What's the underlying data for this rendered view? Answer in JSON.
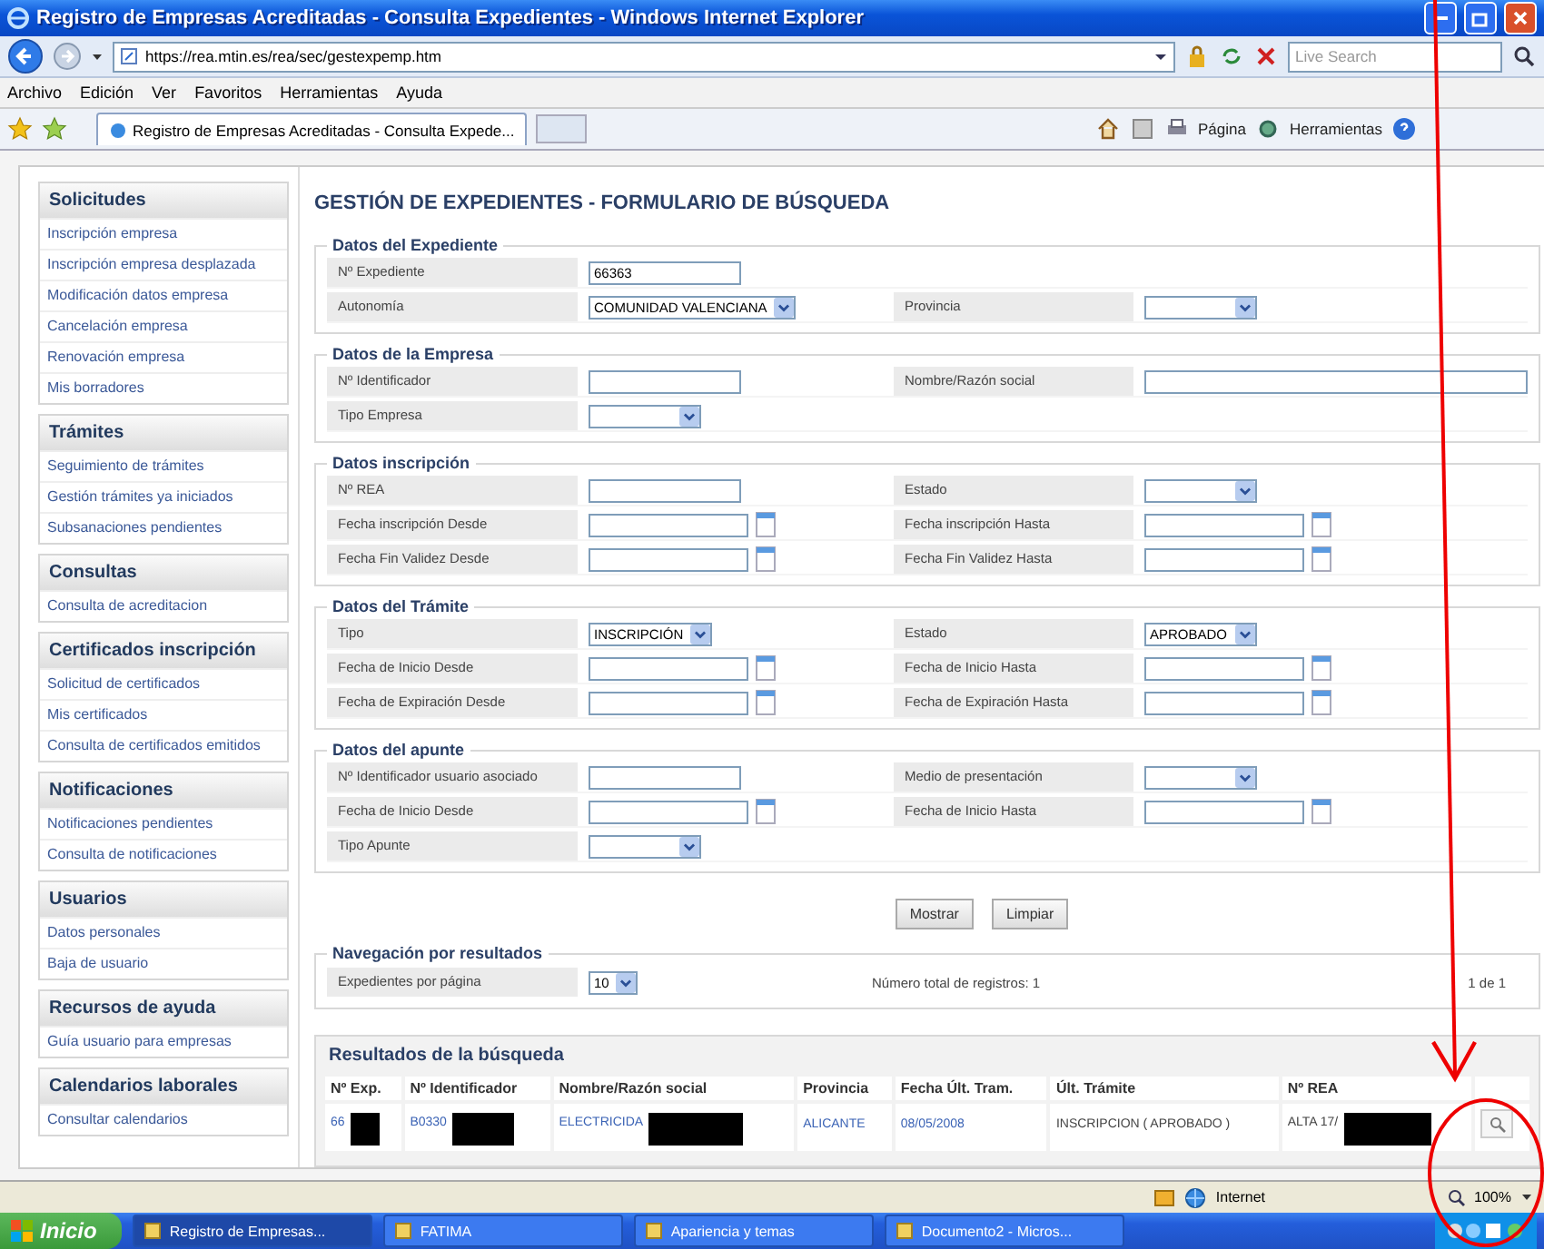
{
  "window": {
    "title": "Registro de Empresas Acreditadas - Consulta Expedientes - Windows Internet Explorer"
  },
  "address_bar": {
    "url": "https://rea.mtin.es/rea/sec/gestexpemp.htm",
    "search_placeholder": "Live Search"
  },
  "menu_bar": [
    "Archivo",
    "Edición",
    "Ver",
    "Favoritos",
    "Herramientas",
    "Ayuda"
  ],
  "browser_tabs": [
    {
      "label": "Registro de Empresas Acreditadas - Consulta Expede...",
      "selected": true
    }
  ],
  "command_bar": [
    "Página",
    "Herramientas"
  ],
  "sidebar": [
    {
      "title": "Solicitudes",
      "items": [
        "Inscripción empresa",
        "Inscripción empresa desplazada",
        "Modificación datos empresa",
        "Cancelación empresa",
        "Renovación empresa",
        "Mis borradores"
      ]
    },
    {
      "title": "Trámites",
      "items": [
        "Seguimiento de trámites",
        "Gestión trámites ya iniciados",
        "Subsanaciones pendientes"
      ]
    },
    {
      "title": "Consultas",
      "items": [
        "Consulta de acreditacion"
      ]
    },
    {
      "title": "Certificados inscripción",
      "items": [
        "Solicitud de certificados",
        "Mis certificados",
        "Consulta de certificados emitidos"
      ]
    },
    {
      "title": "Notificaciones",
      "items": [
        "Notificaciones pendientes",
        "Consulta de notificaciones"
      ]
    },
    {
      "title": "Usuarios",
      "items": [
        "Datos personales",
        "Baja de usuario"
      ]
    },
    {
      "title": "Recursos de ayuda",
      "items": [
        "Guía usuario para empresas"
      ]
    },
    {
      "title": "Calendarios laborales",
      "items": [
        "Consultar calendarios"
      ]
    }
  ],
  "page_title": "GESTIÓN DE EXPEDIENTES - FORMULARIO DE BÚSQUEDA",
  "fieldsets": [
    {
      "legend": "Datos del Expediente",
      "rows": [
        [
          {
            "label": "Nº Expediente",
            "kind": "text",
            "value": "66363"
          }
        ],
        [
          {
            "label": "Autonomía",
            "kind": "select",
            "value": "COMUNIDAD VALENCIANA"
          },
          {
            "label": "Provincia",
            "kind": "select"
          }
        ]
      ]
    },
    {
      "legend": "Datos de la Empresa",
      "rows": [
        [
          {
            "label": "Nº Identificador",
            "kind": "text"
          },
          {
            "label": "Nombre/Razón social",
            "kind": "text"
          }
        ],
        [
          {
            "label": "Tipo Empresa",
            "kind": "select"
          }
        ]
      ]
    },
    {
      "legend": "Datos inscripción",
      "rows": [
        [
          {
            "label": "Nº REA",
            "kind": "text"
          },
          {
            "label": "Estado",
            "kind": "select"
          }
        ],
        [
          {
            "label": "Fecha inscripción Desde",
            "kind": "date"
          },
          {
            "label": "Fecha inscripción Hasta",
            "kind": "date"
          }
        ],
        [
          {
            "label": "Fecha Fin Validez Desde",
            "kind": "date"
          },
          {
            "label": "Fecha Fin Validez Hasta",
            "kind": "date"
          }
        ]
      ]
    },
    {
      "legend": "Datos del Trámite",
      "rows": [
        [
          {
            "label": "Tipo",
            "kind": "select",
            "value": "INSCRIPCIÓN"
          },
          {
            "label": "Estado",
            "kind": "select",
            "value": "APROBADO"
          }
        ],
        [
          {
            "label": "Fecha de Inicio Desde",
            "kind": "date"
          },
          {
            "label": "Fecha de Inicio Hasta",
            "kind": "date"
          }
        ],
        [
          {
            "label": "Fecha de Expiración Desde",
            "kind": "date"
          },
          {
            "label": "Fecha de Expiración Hasta",
            "kind": "date"
          }
        ]
      ]
    },
    {
      "legend": "Datos del apunte",
      "rows": [
        [
          {
            "label": "Nº Identificador usuario asociado",
            "kind": "text"
          },
          {
            "label": "Medio de presentación",
            "kind": "select"
          }
        ],
        [
          {
            "label": "Fecha de Inicio Desde",
            "kind": "date"
          },
          {
            "label": "Fecha de Inicio Hasta",
            "kind": "date"
          }
        ],
        [
          {
            "label": "Tipo Apunte",
            "kind": "select"
          }
        ]
      ]
    }
  ],
  "buttons": [
    "Mostrar",
    "Limpiar"
  ],
  "navigation": {
    "legend": "Navegación por resultados",
    "label": "Expedientes por página",
    "per_page": "10",
    "total": "Número total de registros: 1",
    "pages": "1 de 1"
  },
  "results": {
    "title": "Resultados de la búsqueda",
    "columns": [
      "Nº Exp.",
      "Nº Identificador",
      "Nombre/Razón social",
      "Provincia",
      "Fecha Últ. Tram.",
      "Últ. Trámite",
      "Nº REA"
    ],
    "rows": [
      {
        "cells": [
          {
            "text": "66",
            "link": true,
            "redacted": true
          },
          {
            "text": "B0330",
            "link": true,
            "redacted": true
          },
          {
            "text": "ELECTRICIDA",
            "link": true,
            "redacted": true
          },
          {
            "text": "ALICANTE",
            "link": true,
            "redacted": false
          },
          {
            "text": "08/05/2008",
            "link": true,
            "redacted": false
          },
          {
            "text": "INSCRIPCION ( APROBADO )",
            "link": false,
            "redacted": false
          },
          {
            "text": "ALTA 17/",
            "link": false,
            "redacted": true
          }
        ]
      }
    ]
  },
  "status_bar": {
    "zone": "Internet",
    "zoom": "100%"
  },
  "taskbar": {
    "start": "Inicio",
    "items": [
      {
        "label": "Registro de Empresas...",
        "selected": true
      },
      {
        "label": "FATIMA",
        "selected": false
      },
      {
        "label": "Apariencia y temas",
        "selected": false
      },
      {
        "label": "Documento2 - Micros...",
        "selected": false
      }
    ]
  }
}
